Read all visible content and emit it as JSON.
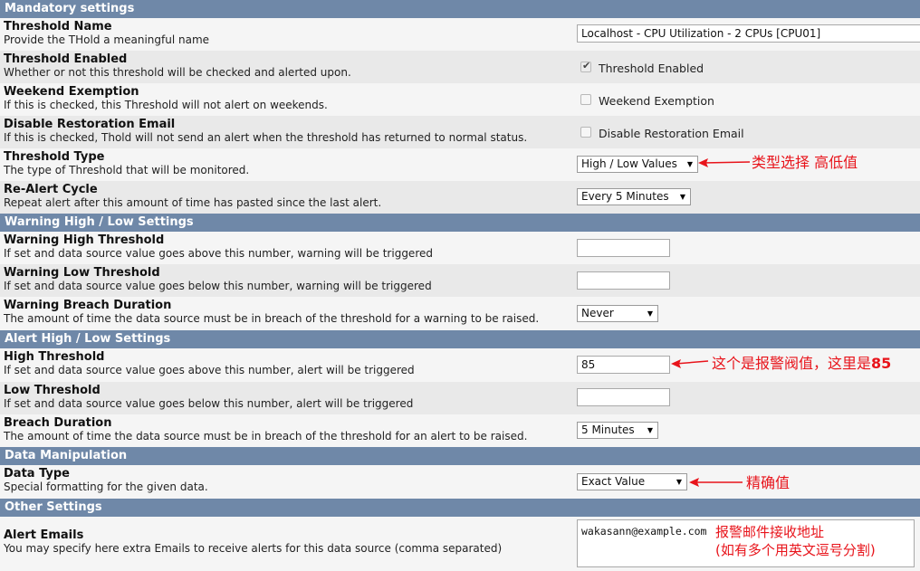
{
  "sections": {
    "mandatory": "Mandatory settings",
    "warning": "Warning High / Low Settings",
    "alert": "Alert High / Low Settings",
    "data": "Data Manipulation",
    "other": "Other Settings"
  },
  "rows": {
    "name": {
      "title": "Threshold Name",
      "desc": "Provide the THold a meaningful name",
      "value": "Localhost - CPU Utilization - 2 CPUs [CPU01]"
    },
    "enabled": {
      "title": "Threshold Enabled",
      "desc": "Whether or not this threshold will be checked and alerted upon.",
      "checkbox_label": "Threshold Enabled",
      "checked": true
    },
    "weekend": {
      "title": "Weekend Exemption",
      "desc": "If this is checked, this Threshold will not alert on weekends.",
      "checkbox_label": "Weekend Exemption",
      "checked": false
    },
    "restoration": {
      "title": "Disable Restoration Email",
      "desc": "If this is checked, Thold will not send an alert when the threshold has returned to normal status.",
      "checkbox_label": "Disable Restoration Email",
      "checked": false
    },
    "type": {
      "title": "Threshold Type",
      "desc": "The type of Threshold that will be monitored.",
      "selected": "High / Low Values"
    },
    "realert": {
      "title": "Re-Alert Cycle",
      "desc": "Repeat alert after this amount of time has pasted since the last alert.",
      "selected": "Every 5 Minutes"
    },
    "warn_high": {
      "title": "Warning High Threshold",
      "desc": "If set and data source value goes above this number, warning will be triggered",
      "value": ""
    },
    "warn_low": {
      "title": "Warning Low Threshold",
      "desc": "If set and data source value goes below this number, warning will be triggered",
      "value": ""
    },
    "warn_duration": {
      "title": "Warning Breach Duration",
      "desc": "The amount of time the data source must be in breach of the threshold for a warning to be raised.",
      "selected": "Never"
    },
    "high": {
      "title": "High Threshold",
      "desc": "If set and data source value goes above this number, alert will be triggered",
      "value": "85"
    },
    "low": {
      "title": "Low Threshold",
      "desc": "If set and data source value goes below this number, alert will be triggered",
      "value": ""
    },
    "duration": {
      "title": "Breach Duration",
      "desc": "The amount of time the data source must be in breach of the threshold for an alert to be raised.",
      "selected": "5 Minutes"
    },
    "datatype": {
      "title": "Data Type",
      "desc": "Special formatting for the given data.",
      "selected": "Exact Value"
    },
    "emails": {
      "title": "Alert Emails",
      "desc": "You may specify here extra Emails to receive alerts for this data source (comma separated)",
      "value": "wakasann@example.com"
    }
  },
  "annotations": {
    "type": "类型选择 高低值",
    "high_prefix": "这个是报警阀值，这里是",
    "high_value": "85",
    "datatype": "精确值",
    "emails_line1": "报警邮件接收地址",
    "emails_line2": "(如有多个用英文逗号分割)",
    "color": "#e8141b"
  },
  "colors": {
    "section_header": "#6f88a8",
    "row_odd": "#f5f5f5",
    "row_even": "#e9e9e9"
  }
}
